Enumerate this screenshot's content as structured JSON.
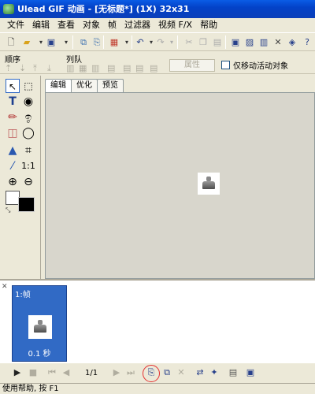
{
  "window": {
    "title": "Ulead GIF 动画 - [无标题*] (1X) 32x31"
  },
  "menu": [
    "文件",
    "编辑",
    "查看",
    "对象",
    "帧",
    "过滤器",
    "视频 F/X",
    "帮助"
  ],
  "labelbar": {
    "order_label": "顺序",
    "queue_label": "列队",
    "properties_button": "属性",
    "checkbox_label": "仅移动活动对象"
  },
  "tabs": [
    "编辑",
    "优化",
    "预览"
  ],
  "frame_panel": {
    "frame_label": "1:帧",
    "frame_time": "0.1 秒"
  },
  "playback": {
    "counter": "1/1"
  },
  "status": "使用帮助, 按 F1",
  "colors": {
    "title_bar": "#0a5ce6",
    "selection": "#316ac5",
    "highlight_circle": "#e53030"
  },
  "icons": [
    "new-file-icon",
    "open-icon",
    "save-icon",
    "export-icon",
    "palette-icon",
    "undo-icon",
    "redo-icon",
    "cut-icon",
    "copy-icon",
    "paste-icon",
    "delete-icon",
    "play-icon",
    "stop-icon"
  ]
}
